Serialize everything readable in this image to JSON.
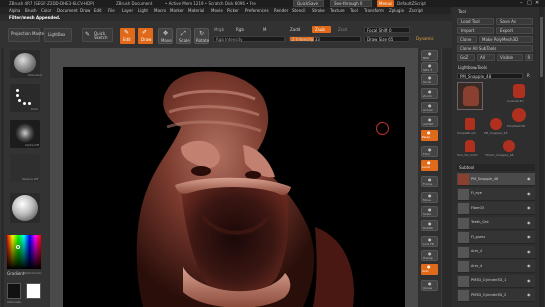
{
  "title_bar": {
    "app_title": "ZBrush 4R7 (SEGF-Z2DD-DHE3-6LCV-HDP)",
    "doc_label": "ZBrush Document",
    "free_mem": "• Active Mem 1219 • Scratch Disk 6096 • Fre",
    "quick_save": "QuickSave",
    "see_through": "See-through 0",
    "menus_label": "Menus",
    "default_script": "DefaultZScript"
  },
  "menu_items": [
    "Alpha",
    "Brush",
    "Color",
    "Document",
    "Draw",
    "Edit",
    "File",
    "Layer",
    "Light",
    "Macro",
    "Marker",
    "Material",
    "Movie",
    "Picker",
    "Preferences",
    "Render",
    "Stencil",
    "Stroke",
    "Texture",
    "Tool",
    "Transform",
    "Zplugin",
    "Zscript"
  ],
  "notification": "Filter/mesh Appended.",
  "toolbar": {
    "projection_master": "Projection Master",
    "lightbox": "LightBox",
    "quick_sketch": "Quick Sketch",
    "edit": "Edit",
    "draw": "Draw",
    "move": "Move",
    "scale": "Scale",
    "rotate": "Rotate",
    "mrgb": "Mrgb",
    "rgb": "Rgb",
    "m": "M",
    "rgb_intensity": "Rgb Intensity",
    "zadd": "Zadd",
    "zsub": "Zsub",
    "zcut": "Zcut",
    "z_intensity": "Z Intensity 33",
    "focal_shift": "Focal Shift 0",
    "draw_size": "Draw Size 65",
    "dynamic": "Dynamic"
  },
  "left_shelf": {
    "standard_label": "Standard",
    "dots_label": "Dots",
    "alpha_label": "Alpha Off",
    "texture_label": "Texture Off",
    "material_label": "MatCap Gray",
    "gradient": "Gradient",
    "switch_color": "SwitchColor",
    "alternate": "Alternate"
  },
  "right_shelf": [
    "BPR",
    "SPix 3",
    "Scroll",
    "Zoom",
    "Actual",
    "AAHalf",
    "Persp",
    "Floor",
    "Local",
    "Frame",
    "Move",
    "Scale",
    "Rotate",
    "Line Fill",
    "Transp",
    "Solo",
    "Xpose"
  ],
  "tool_panel": {
    "title": "Tool",
    "load_tool": "Load Tool",
    "save_as": "Save As",
    "import": "Import",
    "export": "Export",
    "clone": "Clone",
    "make_polymesh": "Make PolyMesh3D",
    "clone_all_subtools": "Clone All SubTools",
    "goz": "GoZ",
    "all": "All",
    "visible": "Visible",
    "r": "R",
    "lightbox_tools": "Lightbox▸Tools",
    "current_tool": "PM_Snapple_48",
    "r_count": "R",
    "thumbnails": [
      "PM_Snapple_48",
      "Cylinder3D",
      "PolyMesh3D",
      "SimpleBrush",
      "PM_Snapple_48",
      "Tool_SS_tooth",
      "TPrsnt_Snapple_48"
    ],
    "subtool_label": "Subtool",
    "subtools": [
      "PM_Snapple_48",
      "Fi_eye",
      "Fiber03",
      "Teeth_Grd",
      "Fi_gums",
      "Arm_4",
      "Arm_4",
      "PM3D_Cylinder3D_1",
      "PM3D_Cylinder3D_2"
    ]
  }
}
